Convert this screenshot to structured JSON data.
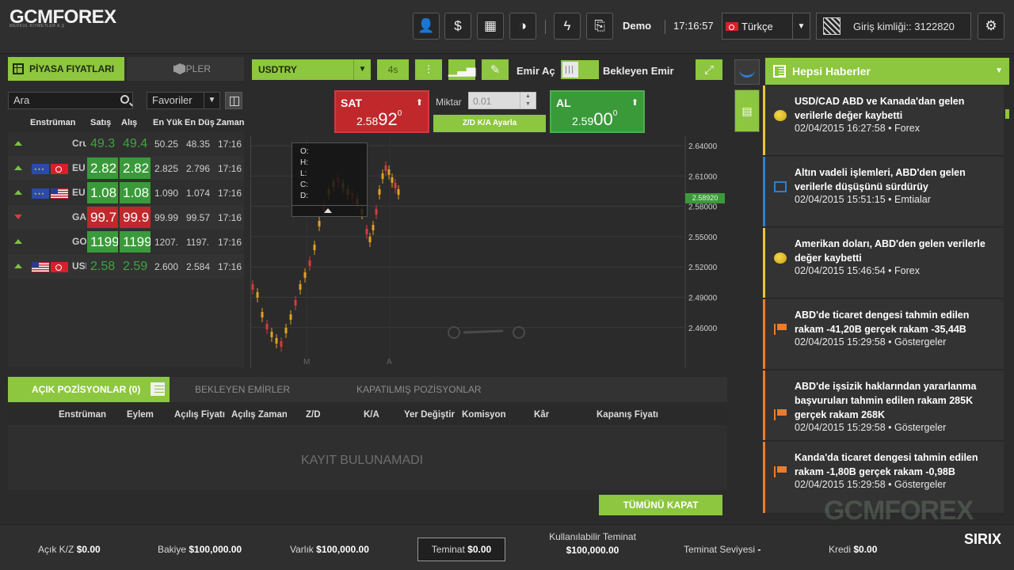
{
  "brand": {
    "logo": "GCMFOREX",
    "tagline": "MEDKUL KIYMETLER A.Ş"
  },
  "topbar": {
    "buttons": [
      "account-icon",
      "deposit-icon",
      "calendar-icon",
      "theme-icon",
      "lightning-icon",
      "document-add-icon"
    ],
    "mode": "Demo",
    "time": "17:16:57",
    "language": "Türkçe",
    "login_id": "Giriş kimliği:: 3122820"
  },
  "market_panel": {
    "tab_prices": "PİYASA FIYATLARI",
    "tab_cubes": "KÜPLER",
    "search_placeholder": "Ara",
    "favorites": "Favoriler",
    "columns": [
      "Enstrüman",
      "Satış",
      "Alış",
      "En Yüks",
      "En Düş",
      "Zaman"
    ],
    "rows": [
      {
        "dir": "up",
        "flags": [],
        "sym": "Cru",
        "sell": "49.3",
        "buy": "49.4",
        "sell_style": "dim",
        "buy_style": "dim",
        "high": "50.25",
        "low": "48.35",
        "time": "17:16"
      },
      {
        "dir": "up",
        "flags": [
          "eu",
          "tr"
        ],
        "sym": "EU",
        "sell": "2.82",
        "buy": "2.82",
        "sell_style": "green",
        "buy_style": "green",
        "high": "2.825",
        "low": "2.796",
        "time": "17:16"
      },
      {
        "dir": "up",
        "flags": [
          "eu",
          "us"
        ],
        "sym": "EU",
        "sell": "1.08",
        "buy": "1.08",
        "sell_style": "green",
        "buy_style": "green",
        "high": "1.090",
        "low": "1.074",
        "time": "17:16"
      },
      {
        "dir": "down",
        "flags": [],
        "sym": "GA",
        "sell": "99.7",
        "buy": "99.9",
        "sell_style": "red",
        "buy_style": "red",
        "high": "99.99",
        "low": "99.57",
        "time": "17:16"
      },
      {
        "dir": "up",
        "flags": [],
        "sym": "GO",
        "sell": "1199",
        "buy": "1199",
        "sell_style": "green",
        "buy_style": "green",
        "high": "1207.",
        "low": "1197.",
        "time": "17:16"
      },
      {
        "dir": "up",
        "flags": [
          "us",
          "tr"
        ],
        "sym": "USI",
        "sell": "2.58",
        "buy": "2.59",
        "sell_style": "dim",
        "buy_style": "dim",
        "high": "2.600",
        "low": "2.584",
        "time": "17:16"
      }
    ]
  },
  "chart_panel": {
    "symbol": "USDTRY",
    "timeframe": "4s",
    "order_open": "Emir Aç",
    "pending_order": "Bekleyen Emir",
    "sell": {
      "label": "SAT",
      "price_pre": "2.58",
      "price_big": "92",
      "price_sup": "0"
    },
    "buy": {
      "label": "AL",
      "price_pre": "2.59",
      "price_big": "00",
      "price_sup": "0"
    },
    "qty_label": "Miktar",
    "qty_value": "0.01",
    "sltp_button": "Z/D K/A Ayarla",
    "ohlc_labels": [
      "O:",
      "H:",
      "L:",
      "C:",
      "D:"
    ],
    "current_price": "2.58920",
    "y_ticks": [
      "2.64000",
      "2.61000",
      "2.58000",
      "2.55000",
      "2.52000",
      "2.49000",
      "2.46000"
    ],
    "x_ticks": [
      "M",
      "A"
    ]
  },
  "positions": {
    "tab_open": "AÇIK POZİSYONLAR (0)",
    "tab_pending": "BEKLEYEN EMİRLER",
    "tab_closed": "KAPATILMIŞ POZİSYONLAR",
    "columns": [
      "Enstrüman",
      "Eylem",
      "Açılış Fiyatı",
      "Açılış Zamanı",
      "Z/D",
      "K/A",
      "Yer Değiştir",
      "Komisyon",
      "Kâr",
      "Kapanış Fiyatı"
    ],
    "empty_text": "KAYIT BULUNAMADI",
    "close_all": "TÜMÜNÜ KAPAT"
  },
  "news": {
    "title": "Hepsi Haberler",
    "items": [
      {
        "icon": "coin",
        "color": "#e8c53a",
        "title": "USD/CAD ABD ve Kanada'dan gelen verilerle değer kaybetti",
        "meta": "02/04/2015 16:27:58 • Forex"
      },
      {
        "icon": "box",
        "color": "#2e7fd0",
        "title": "Altın vadeli işlemleri, ABD'den gelen verilerle düşüşünü sürdürüy",
        "meta": "02/04/2015 15:51:15 • Emtialar"
      },
      {
        "icon": "coin",
        "color": "#e8c53a",
        "title": "Amerikan doları, ABD'den gelen verilerle değer kaybetti",
        "meta": "02/04/2015 15:46:54 • Forex"
      },
      {
        "icon": "flag",
        "color": "#ea7c2c",
        "title": "ABD'de ticaret dengesi tahmin edilen rakam -41,20B gerçek rakam -35,44B",
        "meta": "02/04/2015 15:29:58 • Göstergeler"
      },
      {
        "icon": "flag",
        "color": "#ea7c2c",
        "title": "ABD'de işsizik haklarından yararlanma başvuruları tahmin edilen rakam 285K gerçek rakam 268K",
        "meta": "02/04/2015 15:29:58 • Göstergeler"
      },
      {
        "icon": "flag",
        "color": "#ea7c2c",
        "title": "Kanda'da ticaret dengesi tahmin edilen rakam -1,80B gerçek rakam -0,98B",
        "meta": "02/04/2015 15:29:58 • Göstergeler"
      }
    ],
    "watermark": "GCMFOREX"
  },
  "footer": {
    "open_pl_label": "Açık K/Z",
    "open_pl": "$0.00",
    "balance_label": "Bakiye",
    "balance": "$100,000.00",
    "equity_label": "Varlık",
    "equity": "$100,000.00",
    "margin_label": "Teminat",
    "margin": "$0.00",
    "free_margin_label": "Kullanılabilir Teminat",
    "free_margin": "$100,000.00",
    "margin_level_label": "Teminat Seviyesi",
    "margin_level": "-",
    "credit_label": "Kredi",
    "credit": "$0.00",
    "brand": "SIRIX"
  }
}
